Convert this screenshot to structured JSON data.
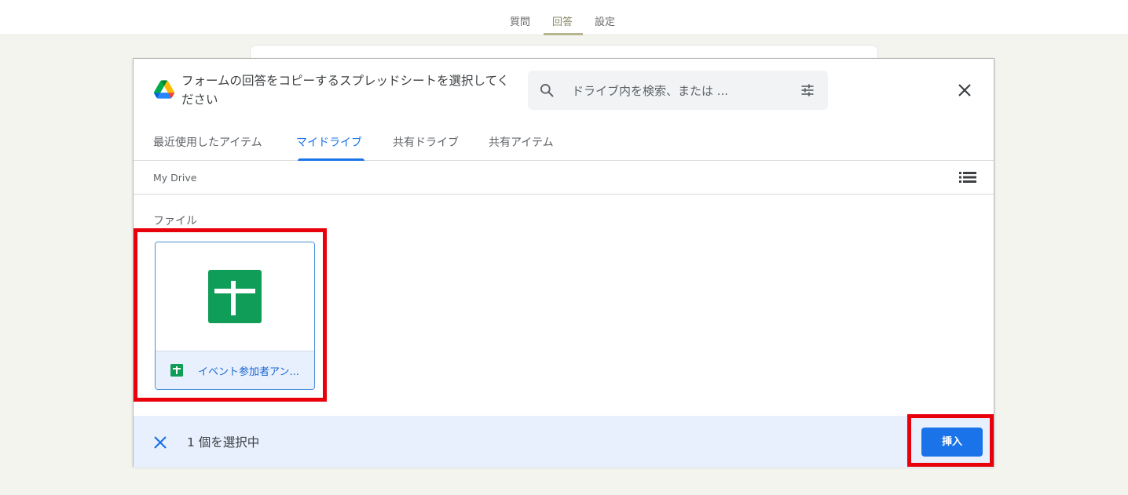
{
  "forms_tabs": [
    {
      "label": "質問"
    },
    {
      "label": "回答"
    },
    {
      "label": "設定"
    }
  ],
  "dialog": {
    "title": "フォームの回答をコピーするスプレッドシートを選択してください",
    "search_placeholder": "ドライブ内を検索、または ...",
    "tabs": [
      {
        "label": "最近使用したアイテム"
      },
      {
        "label": "マイドライブ"
      },
      {
        "label": "共有ドライブ"
      },
      {
        "label": "共有アイテム"
      }
    ],
    "active_tab": "マイドライブ",
    "breadcrumb": "My Drive",
    "section_label": "ファイル",
    "file": {
      "name": "イベント参加者アン...",
      "icon": "google-sheets-icon",
      "selected": true
    },
    "footer": {
      "selection_text": "1 個を選択中",
      "insert_label": "挿入"
    }
  },
  "colors": {
    "accent_blue": "#1a73e8",
    "sheets_green": "#0f9d58",
    "highlight_red": "#e8000b",
    "selection_bg": "#e8f0fe"
  }
}
